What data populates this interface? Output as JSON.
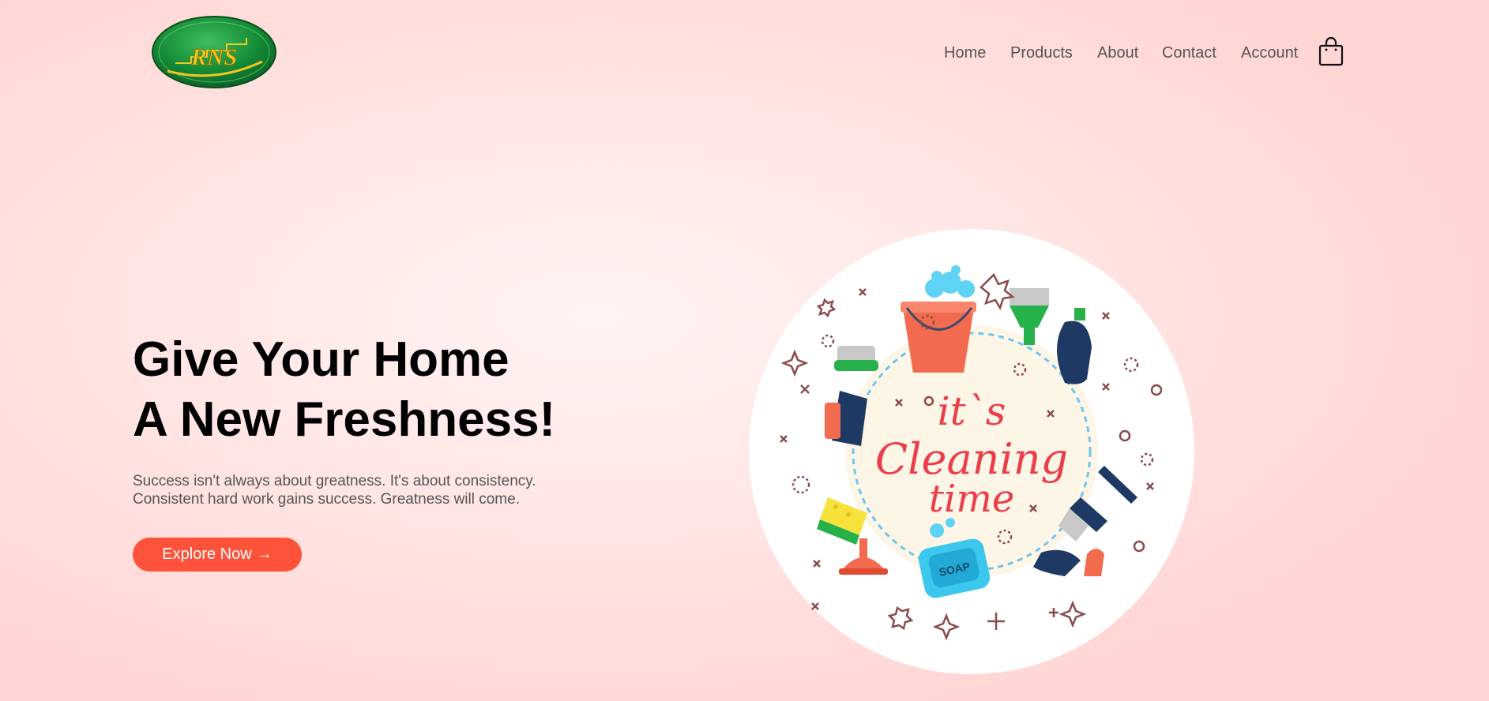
{
  "brand": {
    "logo_text": "RNS",
    "colors": {
      "logo_green": "#138a36",
      "logo_gold": "#f3c623"
    }
  },
  "nav": {
    "items": [
      {
        "label": "Home"
      },
      {
        "label": "Products"
      },
      {
        "label": "About"
      },
      {
        "label": "Contact"
      },
      {
        "label": "Account"
      }
    ],
    "cart_icon": "shopping-bag-icon"
  },
  "hero": {
    "headline_line1": "Give Your Home",
    "headline_line2": "A New Freshness!",
    "subtext_line1": "Success isn't always about greatness. It's about consistency.",
    "subtext_line2": "Consistent hard work gains success. Greatness will come.",
    "cta_label": "Explore Now",
    "cta_arrow": "→",
    "cta_color": "#ff523b",
    "illustration": {
      "line1": "it`s",
      "line2": "Cleaning",
      "line3": "time",
      "soap_label": "SOAP",
      "text_color": "#ec3d4a"
    }
  }
}
